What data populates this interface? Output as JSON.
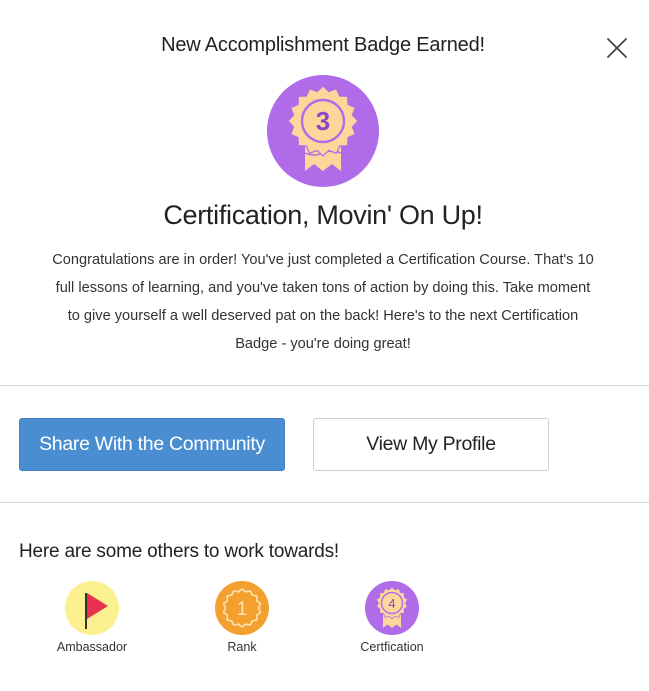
{
  "modal": {
    "header_title": "New Accomplishment Badge Earned!",
    "close_icon": "close-icon",
    "badge": {
      "icon": "ribbon-badge-icon",
      "number": "3",
      "color": "#b06be8",
      "accent": "#fbd79b"
    },
    "badge_title": "Certification, Movin' On Up!",
    "badge_description": "Congratulations are in order! You've just completed a Certification Course. That's 10 full lessons of learning, and you've taken tons of action by doing this. Take moment to give yourself a well deserved pat on the back! Here's to the next Certification Badge - you're doing great!"
  },
  "actions": {
    "share_label": "Share With the Community",
    "profile_label": "View My Profile",
    "share_color": "#4a8ed1"
  },
  "next_badges": {
    "heading": "Here are some others to work towards!",
    "items": [
      {
        "label": "Ambassador",
        "icon": "flag-icon",
        "bg": "#fbf08f",
        "accent": "#e8314f"
      },
      {
        "label": "Rank",
        "icon": "rank-seal-icon",
        "number": "1",
        "bg": "#f3a02e",
        "accent": "#fde3b3"
      },
      {
        "label": "Certfication",
        "icon": "ribbon-badge-icon",
        "number": "4",
        "bg": "#b06be8",
        "accent": "#fbd79b"
      }
    ]
  }
}
